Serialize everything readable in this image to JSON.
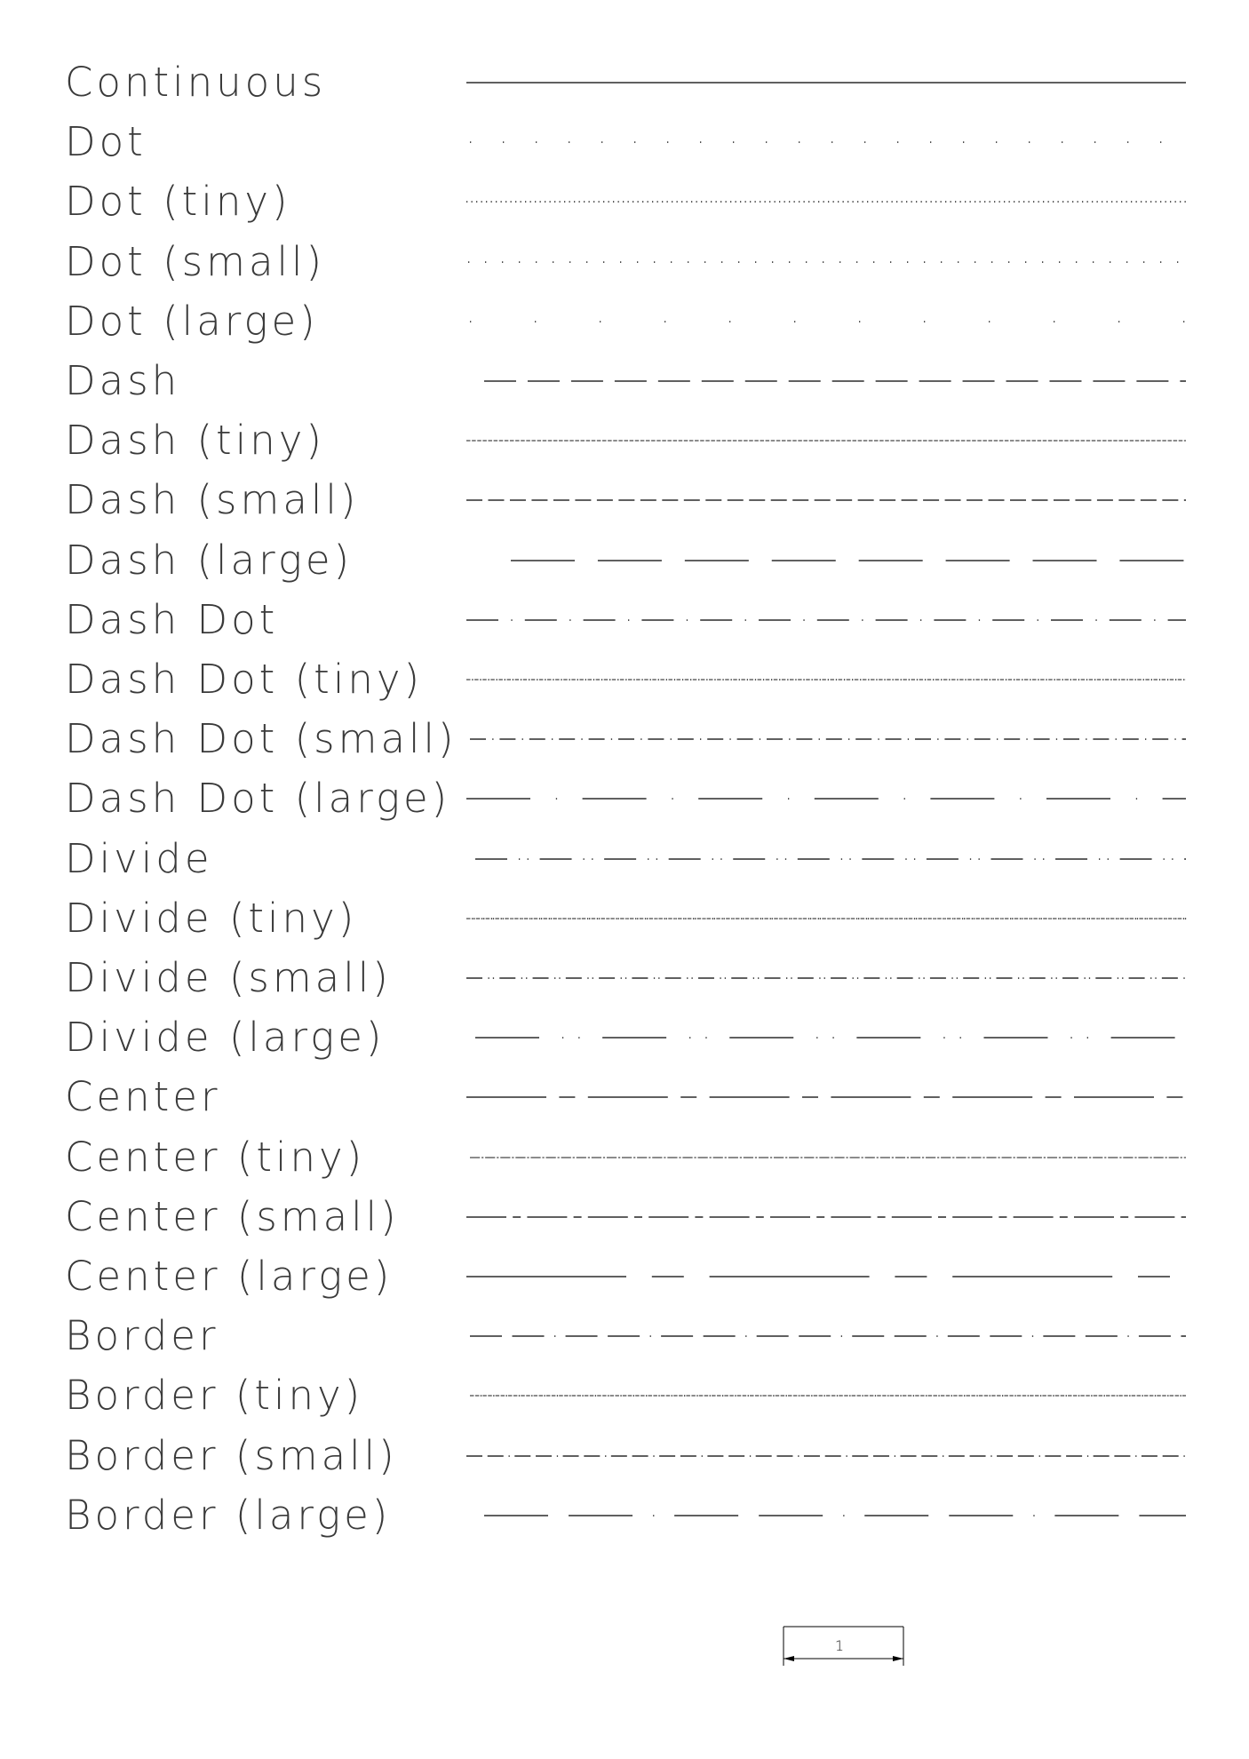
{
  "linetypes": [
    {
      "label": "Continuous",
      "pattern": "continuous",
      "unit": 1,
      "offset": 0
    },
    {
      "label": "Dot",
      "pattern": "dot",
      "unit": 1,
      "offset": 4
    },
    {
      "label": "Dot (tiny)",
      "pattern": "dot",
      "unit": 0.125,
      "offset": 0
    },
    {
      "label": "Dot (small)",
      "pattern": "dot",
      "unit": 0.5,
      "offset": 2
    },
    {
      "label": "Dot (large)",
      "pattern": "dot",
      "unit": 2,
      "offset": 4
    },
    {
      "label": "Dash",
      "pattern": "dash",
      "unit": 1,
      "offset": 20
    },
    {
      "label": "Dash (tiny)",
      "pattern": "dash",
      "unit": 0.125,
      "offset": 0
    },
    {
      "label": "Dash (small)",
      "pattern": "dash",
      "unit": 0.5,
      "offset": 0
    },
    {
      "label": "Dash (large)",
      "pattern": "dash",
      "unit": 2,
      "offset": 50
    },
    {
      "label": "Dash Dot",
      "pattern": "dashdot",
      "unit": 1,
      "offset": 0
    },
    {
      "label": "Dash Dot (tiny)",
      "pattern": "dashdot",
      "unit": 0.125,
      "offset": 0
    },
    {
      "label": "Dash Dot (small)",
      "pattern": "dashdot",
      "unit": 0.5,
      "offset": 4
    },
    {
      "label": "Dash Dot (large)",
      "pattern": "dashdot",
      "unit": 2,
      "offset": 0
    },
    {
      "label": "Divide",
      "pattern": "divide",
      "unit": 1,
      "offset": 10
    },
    {
      "label": "Divide (tiny)",
      "pattern": "divide",
      "unit": 0.125,
      "offset": 0
    },
    {
      "label": "Divide (small)",
      "pattern": "divide",
      "unit": 0.5,
      "offset": 0
    },
    {
      "label": "Divide (large)",
      "pattern": "divide",
      "unit": 2,
      "offset": 10
    },
    {
      "label": "Center",
      "pattern": "center",
      "unit": 1,
      "offset": 0
    },
    {
      "label": "Center (tiny)",
      "pattern": "center",
      "unit": 0.125,
      "offset": 4
    },
    {
      "label": "Center (small)",
      "pattern": "center",
      "unit": 0.5,
      "offset": 0
    },
    {
      "label": "Center (large)",
      "pattern": "center",
      "unit": 2,
      "offset": 0
    },
    {
      "label": "Border",
      "pattern": "border",
      "unit": 1,
      "offset": 4
    },
    {
      "label": "Border (tiny)",
      "pattern": "border",
      "unit": 0.125,
      "offset": 4
    },
    {
      "label": "Border (small)",
      "pattern": "border",
      "unit": 0.5,
      "offset": 0
    },
    {
      "label": "Border (large)",
      "pattern": "border",
      "unit": 2,
      "offset": 20
    }
  ],
  "scale": {
    "label": "1"
  },
  "colors": {
    "text": "#3a3a3a",
    "line": "#000000"
  }
}
